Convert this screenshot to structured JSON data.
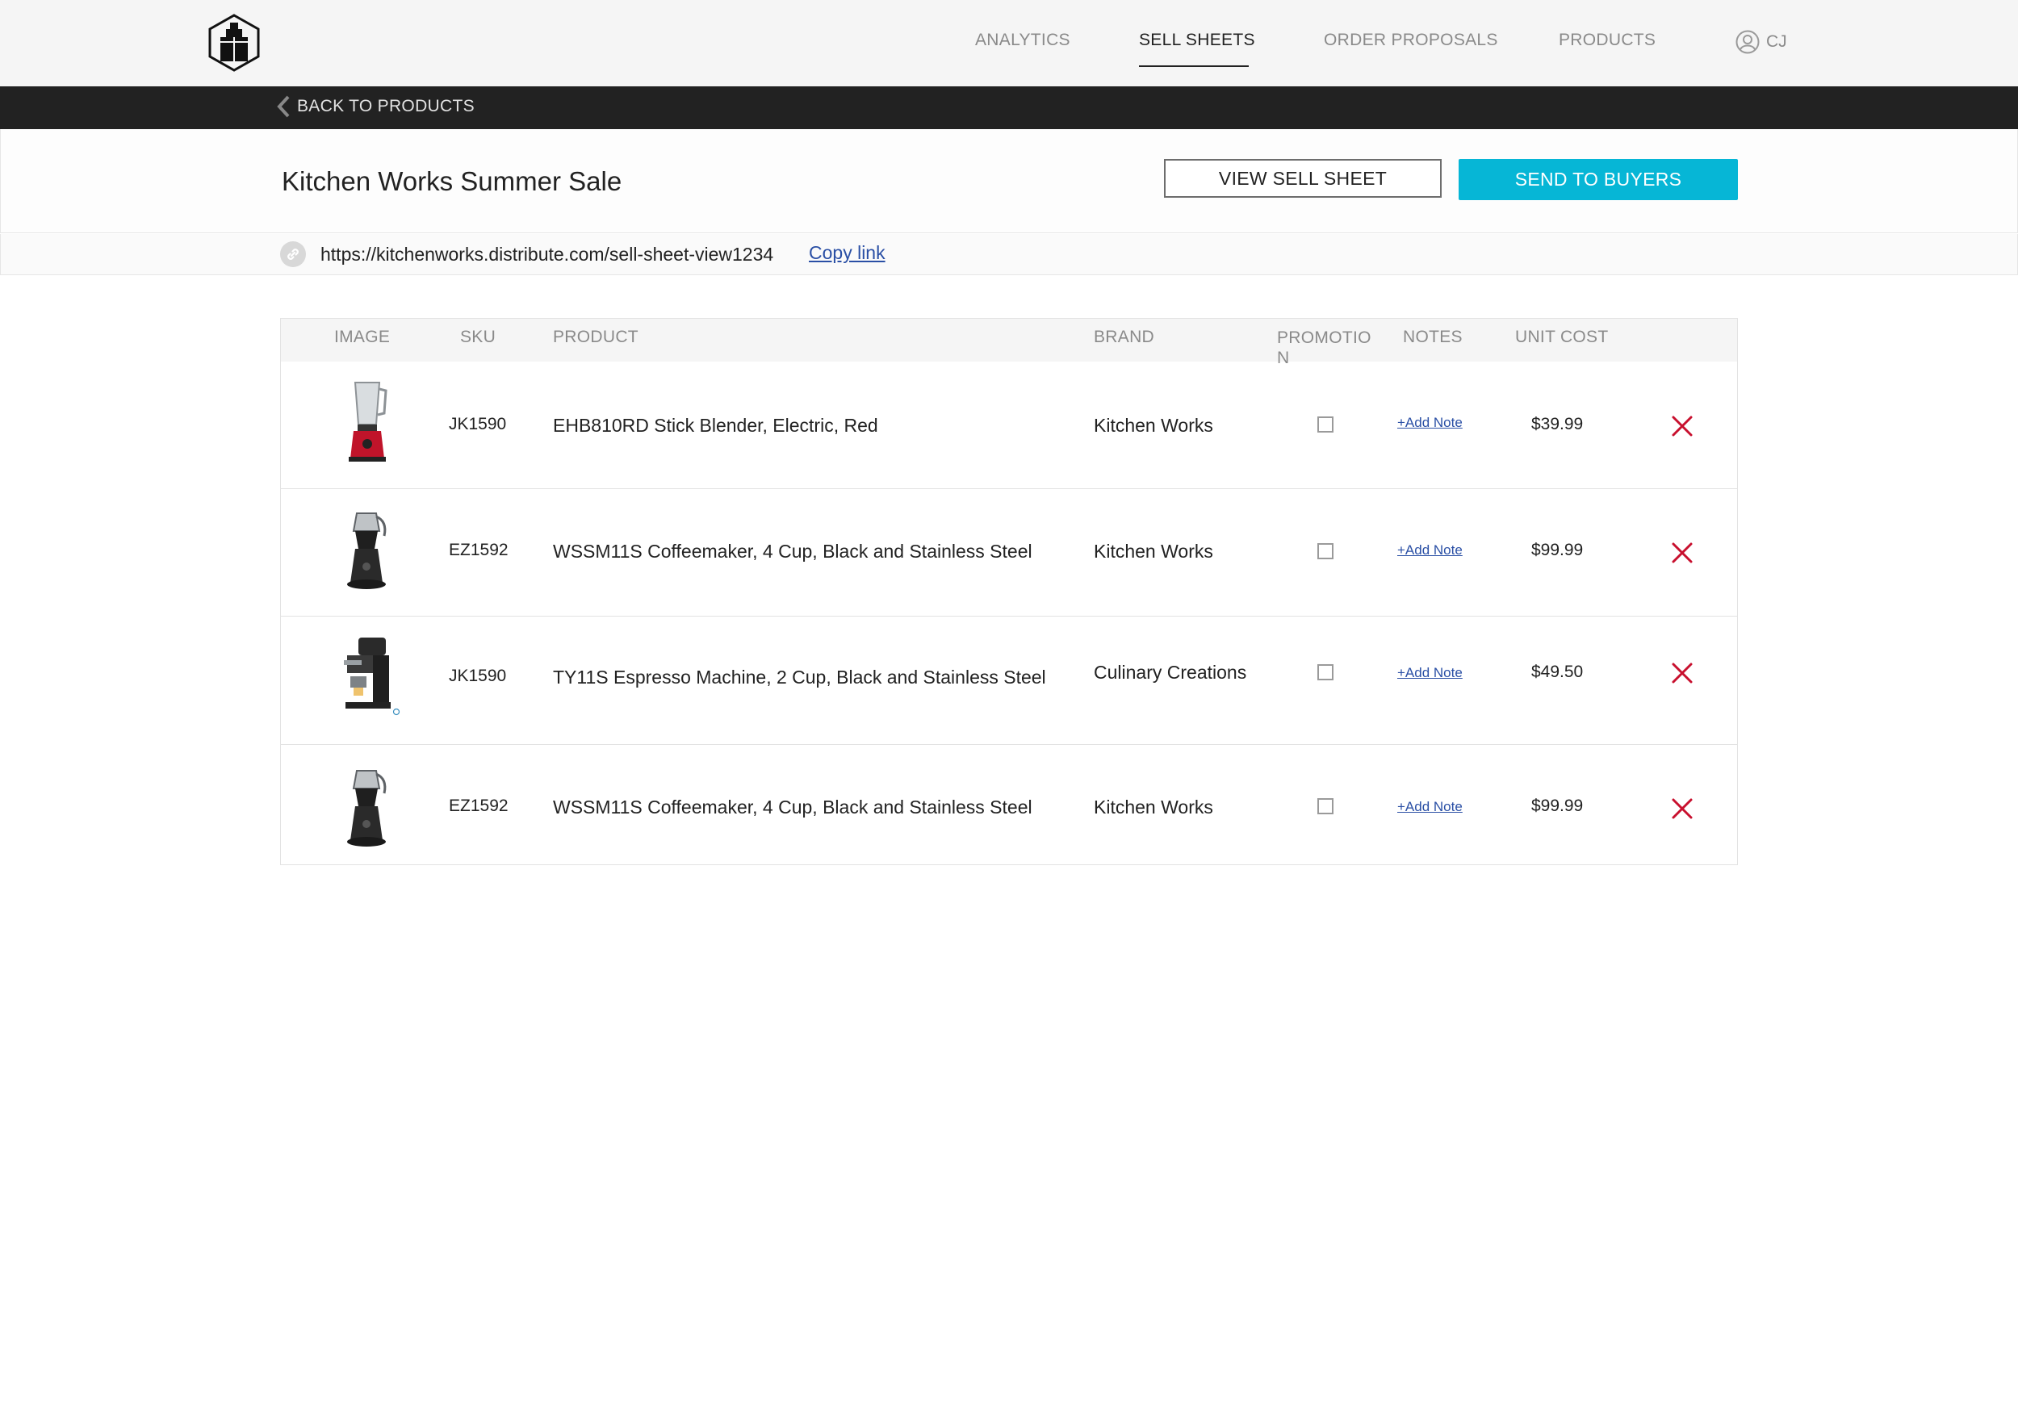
{
  "nav": {
    "items": [
      {
        "label": "ANALYTICS",
        "active": false
      },
      {
        "label": "SELL SHEETS",
        "active": true
      },
      {
        "label": "ORDER PROPOSALS",
        "active": false
      },
      {
        "label": "PRODUCTS",
        "active": false
      }
    ],
    "user_initials": "CJ",
    "logo_icon": "building-hexagon-logo",
    "user_icon": "user-circle-icon"
  },
  "back": {
    "label": "BACK TO PRODUCTS",
    "icon": "chevron-left-icon"
  },
  "sheet": {
    "title": "Kitchen Works Summer Sale",
    "view_button": "VIEW SELL SHEET",
    "send_button": "SEND TO BUYERS",
    "url": "https://kitchenworks.distribute.com/sell-sheet-view1234",
    "copy_link": "Copy link",
    "link_icon": "link-icon"
  },
  "colors": {
    "accent": "#06b6d6",
    "remove": "#c8102e",
    "link": "#2a4fa5",
    "dark_bar": "#222222"
  },
  "table": {
    "columns": [
      "IMAGE",
      "SKU",
      "PRODUCT",
      "BRAND",
      "PROMOTION",
      "NOTES",
      "UNIT COST"
    ],
    "rows": [
      {
        "image": "blender",
        "sku": "JK1590",
        "product": "EHB810RD Stick Blender, Electric, Red",
        "brand": "Kitchen Works",
        "promotion": false,
        "note": "+Add Note",
        "unit_cost": "$39.99"
      },
      {
        "image": "coffeemaker",
        "sku": "EZ1592",
        "product": "WSSM11S Coffeemaker, 4 Cup, Black and Stainless Steel",
        "brand": "Kitchen Works",
        "promotion": false,
        "note": "+Add Note",
        "unit_cost": "$99.99"
      },
      {
        "image": "espresso-machine",
        "sku": "JK1590",
        "product": "TY11S Espresso Machine, 2 Cup, Black and Stainless Steel",
        "brand": "Culinary Creations",
        "promotion": false,
        "note": "+Add Note",
        "unit_cost": "$49.50"
      },
      {
        "image": "coffeemaker",
        "sku": "EZ1592",
        "product": "WSSM11S Coffeemaker, 4 Cup, Black and Stainless Steel",
        "brand": "Kitchen Works",
        "promotion": false,
        "note": "+Add Note",
        "unit_cost": "$99.99"
      }
    ],
    "remove_icon": "close-x-icon"
  }
}
